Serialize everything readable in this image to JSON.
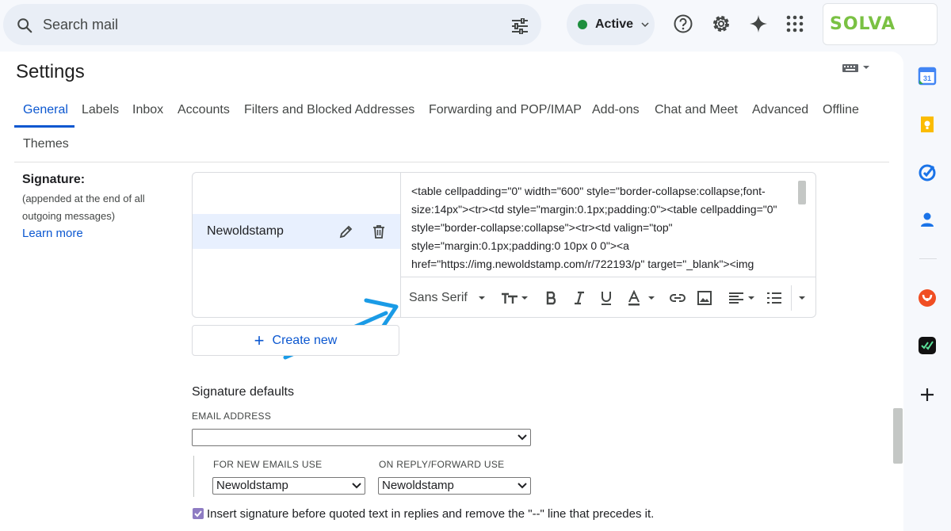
{
  "search": {
    "placeholder": "Search mail"
  },
  "status": {
    "label": "Active",
    "color": "#1e8e3e"
  },
  "brand": {
    "logo_text": "SOLVA",
    "color": "#7ac143"
  },
  "page": {
    "title": "Settings"
  },
  "tabs": [
    {
      "label": "General",
      "active": true
    },
    {
      "label": "Labels"
    },
    {
      "label": "Inbox"
    },
    {
      "label": "Accounts"
    },
    {
      "label": "Filters and Blocked Addresses"
    },
    {
      "label": "Forwarding and POP/IMAP"
    },
    {
      "label": "Add-ons"
    },
    {
      "label": "Chat and Meet"
    },
    {
      "label": "Advanced"
    },
    {
      "label": "Offline"
    },
    {
      "label": "Themes"
    }
  ],
  "signature": {
    "label": "Signature:",
    "sub": "(appended at the end of all outgoing messages)",
    "learn_more": "Learn more",
    "items": [
      {
        "name": "Newoldstamp"
      }
    ],
    "editor_html": "<table cellpadding=\"0\" width=\"600\" style=\"border-collapse:collapse;font-size:14px\"><tr><td style=\"margin:0.1px;padding:0\"><table cellpadding=\"0\" style=\"border-collapse:collapse\"><tr><td valign=\"top\" style=\"margin:0.1px;padding:0 10px 0 0\"><a href=\"https://img.newoldstamp.com/r/722193/p\" target=\"_blank\"><img",
    "font_select": "Sans Serif",
    "create_new": "Create new"
  },
  "defaults": {
    "title": "Signature defaults",
    "email_label": "EMAIL ADDRESS",
    "email_value": "",
    "new_label": "FOR NEW EMAILS USE",
    "new_value": "Newoldstamp",
    "reply_label": "ON REPLY/FORWARD USE",
    "reply_value": "Newoldstamp"
  },
  "insert_before_quoted": {
    "checked": true,
    "label": "Insert signature before quoted text in replies and remove the \"--\" line that precedes it."
  },
  "colors": {
    "accent": "#0b57d0",
    "annotation_arrow": "#1a9be6"
  }
}
